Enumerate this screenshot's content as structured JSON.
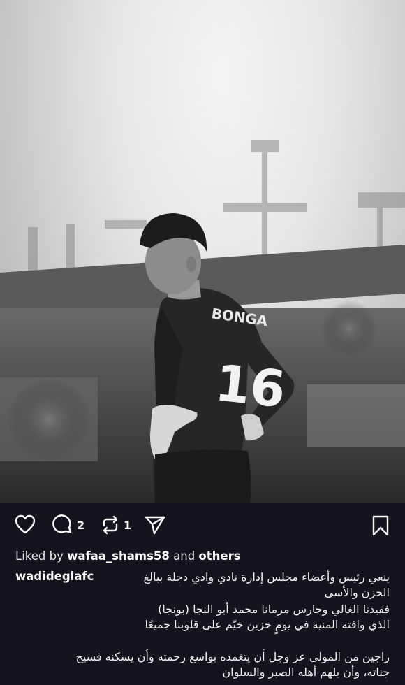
{
  "post": {
    "photo_description_icon": "goalkeeper-photo",
    "jersey_name": "BONGA",
    "jersey_number": "16"
  },
  "actions": {
    "comments_count": "2",
    "reposts_count": "1"
  },
  "likes": {
    "prefix": "Liked by",
    "user": "wafaa_shams58",
    "connector": "and",
    "others": "others"
  },
  "caption": {
    "author": "wadideglafc",
    "line1": "ينعي رئيس وأعضاء مجلس إدارة نادي وادي دجلة ببالغ",
    "line2": "الحزن والأسى",
    "line3": "فقيدنا الغالي وحارس مرمانا  محمد أبو النجا (بونجا)",
    "line4": "الذي وافته المنية في يومٍ حزين خيّم على قلوبنا جميعًا",
    "line5": "راجين من المولى عز وجل أن يتغمده بواسع رحمته وأن يسكنه فسيح",
    "line6": "جناته، وأن يلهم أهله الصبر والسلوان"
  },
  "colors": {
    "background": "#141420",
    "text": "#ffffff"
  }
}
